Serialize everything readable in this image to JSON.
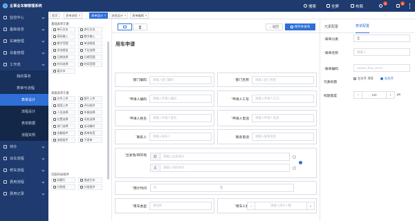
{
  "app": {
    "title": "企事业车辆管理系统"
  },
  "sidebar": {
    "items": [
      {
        "label": "监控中心"
      },
      {
        "label": "基础信息"
      },
      {
        "label": "车辆管理"
      },
      {
        "label": "设备管理"
      },
      {
        "label": "工作流"
      }
    ],
    "workflow_children": [
      {
        "label": "我的事务"
      },
      {
        "label": "表单与流程"
      }
    ],
    "form_children": [
      {
        "label": "表单设计"
      },
      {
        "label": "流程设计"
      },
      {
        "label": "表单数据"
      },
      {
        "label": "流程实例"
      }
    ],
    "items_after": [
      {
        "label": "待办"
      },
      {
        "label": "派车流程"
      },
      {
        "label": "修车流程"
      },
      {
        "label": "费用流程"
      },
      {
        "label": "费用记录"
      }
    ]
  },
  "header": {
    "search_label": "搜索",
    "fullscreen_label": "全屏",
    "layout_label": "布局",
    "notification_count": "5",
    "message_count": "5"
  },
  "tabs": [
    {
      "label": "首页"
    },
    {
      "label": "表单流程"
    },
    {
      "label": "表单设计"
    },
    {
      "label": "流程设计"
    },
    {
      "label": "表单编辑"
    }
  ],
  "components": {
    "basic_title": "基础表单元素",
    "basic": [
      "单行文本",
      "多行文本",
      "密码输入",
      "数字输入",
      "数字范围",
      "单选框组",
      "多选框组",
      "下拉选择",
      "日期选择",
      "日期范围",
      "时间选择",
      "时间范围",
      "富文本"
    ],
    "advanced_title": "高级表单元素",
    "advanced": [
      "文件上传",
      "图片上传",
      "组图上传",
      "评分组件",
      "人员选择",
      "车辆选择",
      "位置选择",
      "司机选择",
      "部门选择",
      "自动编号",
      "金额组件",
      "表单标签",
      "流程组件",
      "子表单"
    ],
    "layout_title": "页面布局组件",
    "layout": [
      "标题行",
      "描述文本",
      "分割线",
      "分组组件"
    ]
  },
  "canvas": {
    "back_label": "返回",
    "save_label": "保存并发布",
    "form_title": "用车申请",
    "fields": {
      "dept": {
        "label": "部门编码",
        "placeholder": "请输入部门编码"
      },
      "dept_name": {
        "label": "部门名称",
        "placeholder": "请输入部门名称"
      },
      "applicant_code": {
        "label": "申请人编码",
        "placeholder": "请输入申请人编码"
      },
      "applicant_no": {
        "label": "申请人工号",
        "placeholder": "请输入申请人工号"
      },
      "applicant_name": {
        "label": "申请人姓名",
        "placeholder": "请输入申请人姓名"
      },
      "applicant_phone": {
        "label": "申请人电话",
        "placeholder": "请输入申请人电话"
      },
      "contact": {
        "label": "联系人",
        "placeholder": "请输入联系人"
      },
      "contact_phone": {
        "label": "联系电话",
        "placeholder": "请输入联系电话"
      },
      "origin": {
        "label": "出发地/目的地",
        "start_label": "起",
        "start_placeholder": "请输入出发地点",
        "end_label": "止",
        "end_placeholder": "请输入目的地点"
      },
      "time": {
        "label": "预计时间",
        "placeholder": "日",
        "sep": "至"
      },
      "car_type": {
        "label": "用车类型",
        "placeholder": "请选择"
      },
      "count": {
        "label": "用车人数",
        "placeholder": "请输入用车人数",
        "minus": "−",
        "plus": "+"
      }
    }
  },
  "props": {
    "tab_element": "元素配置",
    "tab_form": "表单配置",
    "category": {
      "label": "表单分类",
      "value": "无"
    },
    "name": {
      "label": "表单名称",
      "placeholder": "请输入"
    },
    "code": {
      "label": "表单编码",
      "placeholder": "system_flow_vce17"
    },
    "label_position": {
      "label": "元素标题",
      "options": [
        "左对齐 顶部",
        "右对齐"
      ],
      "selected": 1
    },
    "label_width": {
      "label": "标题宽度",
      "value": "120",
      "unit": "px",
      "minus": "−",
      "plus": "+"
    }
  },
  "colors": {
    "sidebar": "#1f3a6e",
    "accent": "#2f6fd6",
    "danger": "#f56c6c"
  }
}
